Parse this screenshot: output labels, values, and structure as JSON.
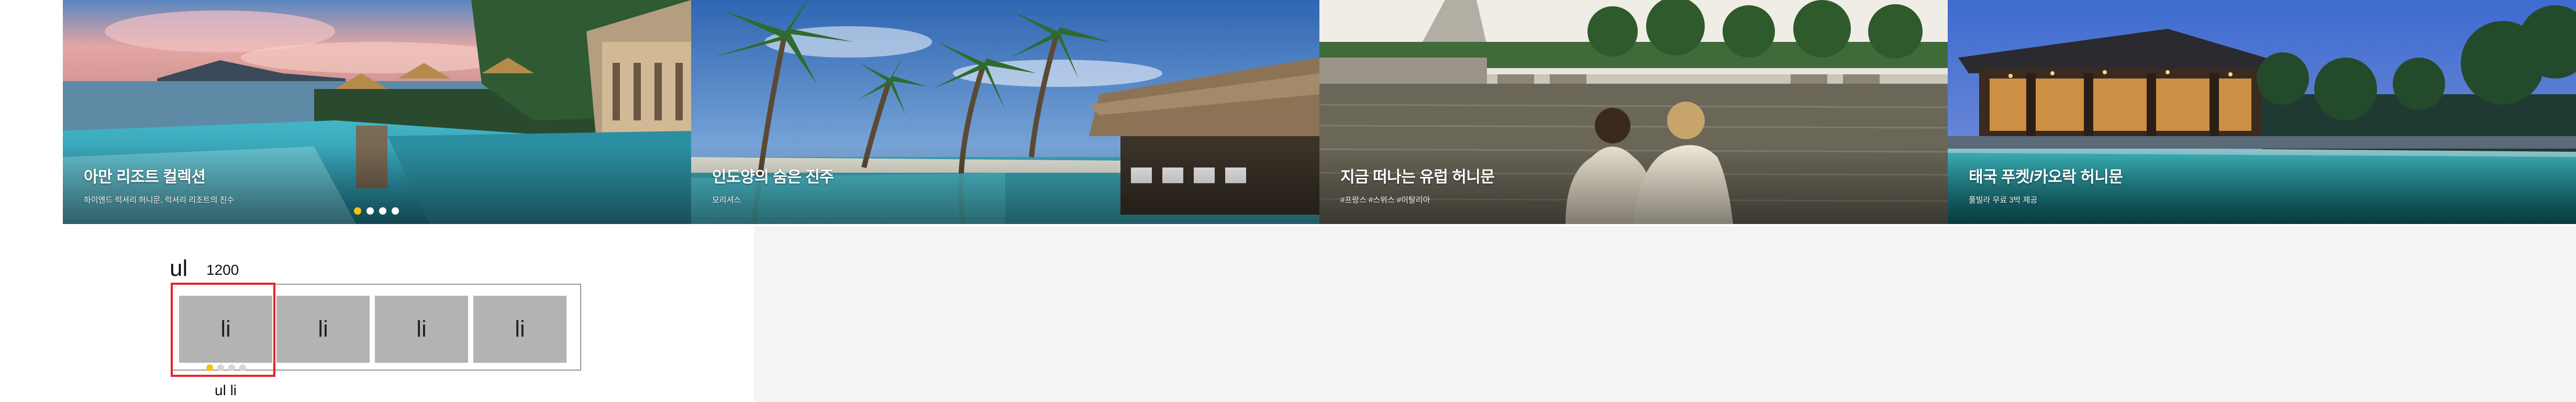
{
  "slides": [
    {
      "title": "아만 리조트 컬렉션",
      "subtitle": "하이엔드 럭셔리 허니문, 럭셔리 리조트의 진수"
    },
    {
      "title": "인도양의 숨은 진주",
      "subtitle": "모리셔스"
    },
    {
      "title": "지금 떠나는 유럽 허니문",
      "subtitle": "#프랑스 #스위스 #이탈리아"
    },
    {
      "title": "태국 푸켓/카오락 허니문",
      "subtitle": "풀빌라 무료 3박 제공"
    }
  ],
  "pagination": {
    "count": 4,
    "active_index": 0,
    "active_color": "#f4c214",
    "inactive_color": "#ffffff"
  },
  "diagram": {
    "ul_label": "ul",
    "width_label": "1200",
    "items": [
      "li",
      "li",
      "li",
      "li"
    ],
    "caption": "ul li",
    "highlight_color": "#e3242b"
  }
}
